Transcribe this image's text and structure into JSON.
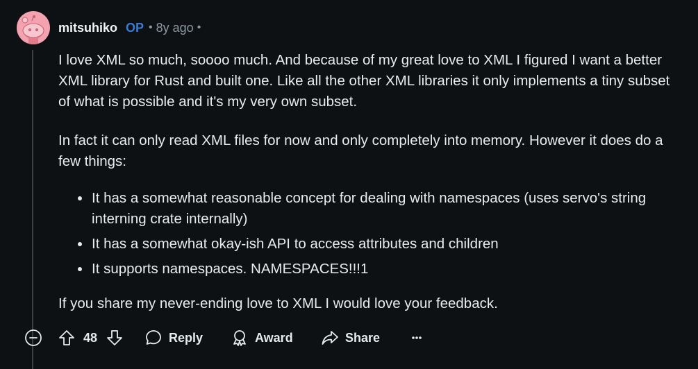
{
  "comment": {
    "author": "mitsuhiko",
    "op_badge": "OP",
    "separator": "•",
    "age": "8y ago",
    "trailing_separator": "•",
    "paragraphs": [
      "I love XML so much, soooo much. And because of my great love to XML I figured I want a better XML library for Rust and built one. Like all the other XML libraries it only implements a tiny subset of what is possible and it's my very own subset.",
      "In fact it can only read XML files for now and only completely into memory. However it does do a few things:"
    ],
    "bullets": [
      "It has a somewhat reasonable concept for dealing with namespaces (uses servo's string interning crate internally)",
      "It has a somewhat okay-ish API to access attributes and children",
      "It supports namespaces. NAMESPACES!!!1"
    ],
    "closing": "If you share my never-ending love to XML I would love your feedback."
  },
  "actions": {
    "score": "48",
    "reply_label": "Reply",
    "award_label": "Award",
    "share_label": "Share",
    "more_label": "•••"
  },
  "icons": {
    "avatar": "snoo-avatar",
    "collapse": "minus-circle-icon",
    "upvote": "upvote-arrow-icon",
    "downvote": "downvote-arrow-icon",
    "reply": "speech-bubble-icon",
    "award": "award-ribbon-icon",
    "share": "share-arrow-icon",
    "more": "ellipsis-icon"
  },
  "colors": {
    "background": "#0e1113",
    "text": "#e8ecee",
    "muted": "#8c9aa3",
    "op_badge": "#3a7bd5",
    "avatar_bg": "#f4a2b0",
    "thread_line": "#3a4044"
  }
}
